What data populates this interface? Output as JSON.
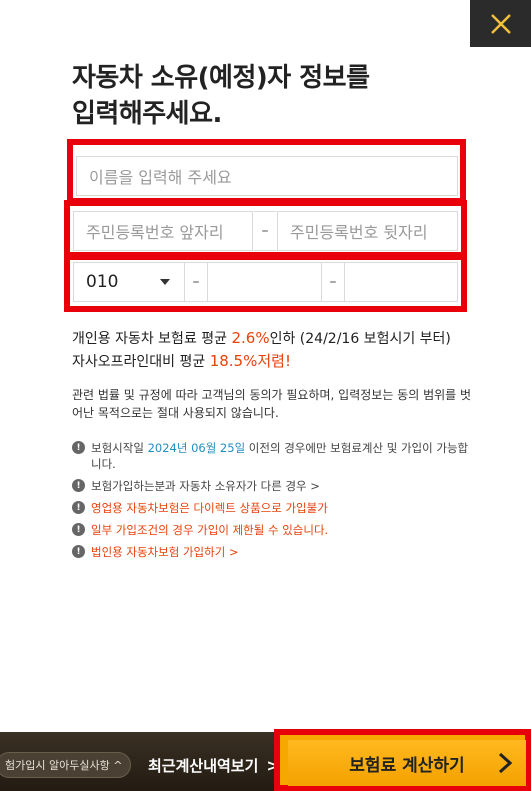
{
  "title_line1": "자동차 소유(예정)자 정보를",
  "title_line2": "입력해주세요.",
  "form": {
    "name_placeholder": "이름을 입력해 주세요",
    "ssn_front_placeholder": "주민등록번호 앞자리",
    "ssn_back_placeholder": "주민등록번호 뒷자리",
    "dash": "–",
    "phone_prefix": "010",
    "phone_middle": "",
    "phone_last": ""
  },
  "discount": {
    "line1_a": "개인용 자동차 보험료 평균 ",
    "line1_pct": "2.6%",
    "line1_b": "인하 (24/2/16 보험시기 부터)",
    "line2_a": "자사오프라인대비 평균 ",
    "line2_pct": "18.5%저렴!"
  },
  "notice": "관련 법률 및 규정에 따라 고객님의 동의가 필요하며, 입력정보는 동의 범위를 벗어난 목적으로는 절대 사용되지 않습니다.",
  "bullets": {
    "b1_a": "보험시작일 ",
    "b1_date": "2024년 06월 25일",
    "b1_b": " 이전의 경우에만 보험료계산 및 가입이 가능합니다.",
    "b2": "보험가입하는분과 자동차 소유자가 다른 경우 >",
    "b3": "영업용 자동차보험은 다이렉트 상품으로 가입불가",
    "b4": "일부 가입조건의 경우 가입이 제한될 수 있습니다.",
    "b5": "법인용 자동차보험 가입하기 >"
  },
  "bottom": {
    "pill_label": "험가입시 알아두실사항 ^",
    "recent_label": "최근계산내역보기",
    "recent_arrow": ">",
    "calc_label": "보험료 계산하기"
  },
  "colors": {
    "accent_red": "#e8000b",
    "accent_orange": "#f4a200",
    "link_blue": "#1f8fbf"
  }
}
